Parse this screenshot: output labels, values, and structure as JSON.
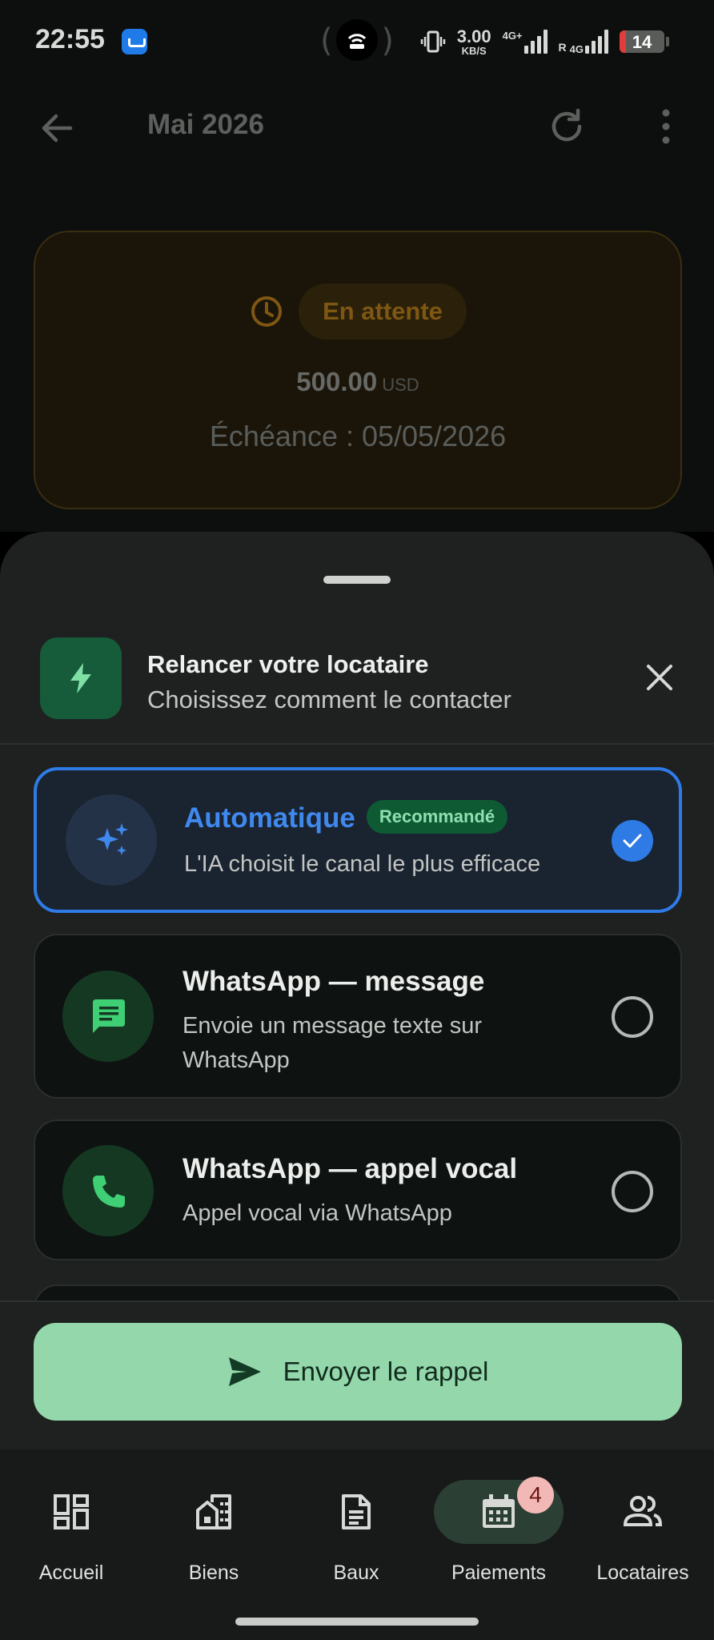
{
  "statusbar": {
    "time": "22:55",
    "speed_value": "3.00",
    "speed_unit": "KB/S",
    "net1_label": "4G+",
    "net2_label_top": "4G",
    "net2_label_bottom": "R",
    "battery_level": "14",
    "icons": [
      "app-notification-icon",
      "hotspot-icon",
      "vibrate-icon",
      "signal-icon",
      "battery-icon"
    ]
  },
  "header": {
    "title": "Mai 2026",
    "icons": [
      "back-arrow-icon",
      "refresh-icon",
      "more-vert-icon"
    ]
  },
  "payment": {
    "status": "En attente",
    "amount": "500.00",
    "currency": "USD",
    "due": "Échéance : 05/05/2026",
    "status_color": "#7e5712"
  },
  "sheet": {
    "title": "Relancer votre locataire",
    "subtitle": "Choisissez comment le contacter",
    "options": [
      {
        "title": "Automatique",
        "badge": "Recommandé",
        "description": "L'IA choisit le canal le plus efficace",
        "icon": "sparkle-icon",
        "selected": true
      },
      {
        "title": "WhatsApp — message",
        "description": "Envoie un message texte sur WhatsApp",
        "icon": "message-icon",
        "selected": false
      },
      {
        "title": "WhatsApp — appel vocal",
        "description": "Appel vocal via WhatsApp",
        "icon": "phone-icon",
        "selected": false
      }
    ],
    "send_label": "Envoyer le rappel",
    "accent_color": "#2e7be6",
    "send_color": "#93d7ab"
  },
  "nav": {
    "items": [
      {
        "label": "Accueil",
        "icon": "dashboard-icon"
      },
      {
        "label": "Biens",
        "icon": "buildings-icon"
      },
      {
        "label": "Baux",
        "icon": "document-icon"
      },
      {
        "label": "Paiements",
        "icon": "calendar-icon",
        "badge": "4",
        "active": true
      },
      {
        "label": "Locataires",
        "icon": "people-icon"
      }
    ]
  }
}
